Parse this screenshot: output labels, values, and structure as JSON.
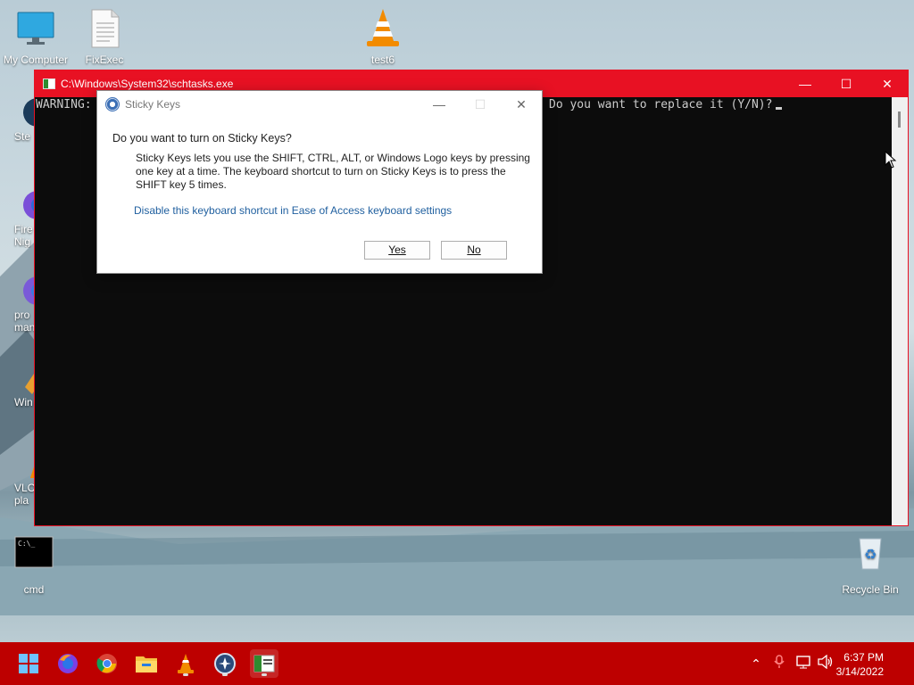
{
  "desktop": {
    "top_icons": [
      {
        "label": "My Computer"
      },
      {
        "label": "FixExec"
      },
      {
        "label": "test6"
      }
    ],
    "side_icons": [
      {
        "label": "Ste"
      },
      {
        "label_lines": [
          "Fire",
          "Nig"
        ]
      },
      {
        "label_lines": [
          "pro",
          "man"
        ]
      },
      {
        "label": "Win"
      },
      {
        "label_lines": [
          "VLC r",
          "pla"
        ]
      }
    ],
    "cmd_icon": {
      "label": "cmd"
    },
    "recycle_bin": {
      "label": "Recycle Bin"
    }
  },
  "console": {
    "title": "C:\\Windows\\System32\\schtasks.exe",
    "left_text": "WARNING:",
    "right_text": "Do you want to replace it (Y/N)?",
    "controls": {
      "minimize": "—",
      "maximize": "☐",
      "close": "✕"
    }
  },
  "dialog": {
    "title": "Sticky Keys",
    "question": "Do you want to turn on Sticky Keys?",
    "description": "Sticky Keys lets you use the SHIFT, CTRL, ALT, or Windows Logo keys by pressing one key at a time. The keyboard shortcut to turn on Sticky Keys is to press the SHIFT key 5 times.",
    "link": "Disable this keyboard shortcut in Ease of Access keyboard settings",
    "yes_label": "Yes",
    "no_label": "No"
  },
  "taskbar": {
    "apps": [
      "start-icon",
      "firefox-icon",
      "chrome-icon",
      "file-explorer-icon",
      "vlc-icon",
      "app-icon",
      "console-app-icon"
    ],
    "clock": {
      "time": "6:37 PM",
      "date": "3/14/2022"
    }
  },
  "colors": {
    "accent": "#e81123",
    "taskbar": "#bd0000",
    "console_bg": "#0c0c0c",
    "link": "#1f5f9f"
  }
}
